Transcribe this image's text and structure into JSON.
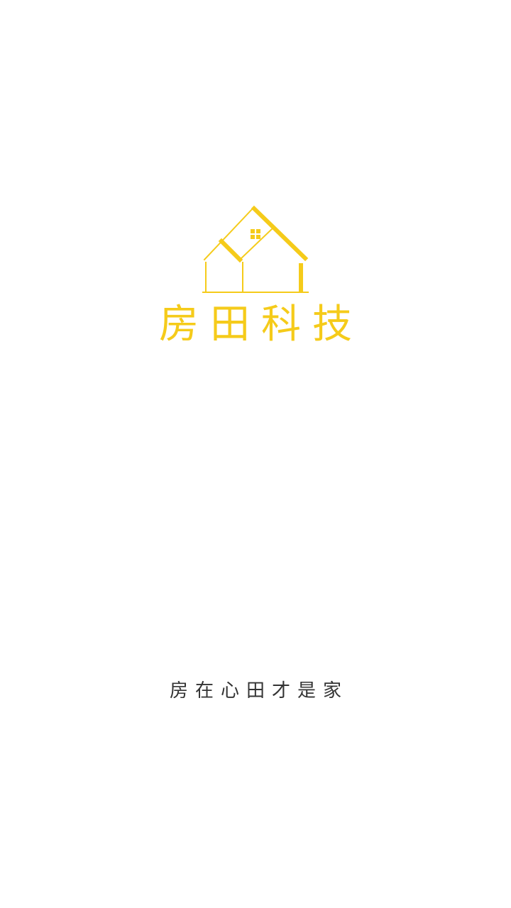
{
  "splash": {
    "brand_name": "房田科技",
    "slogan": "房在心田才是家",
    "logo_icon": "house-outline-icon",
    "colors": {
      "brand": "#F5CB1A",
      "slogan_text": "#333333",
      "background": "#FFFFFF"
    }
  }
}
